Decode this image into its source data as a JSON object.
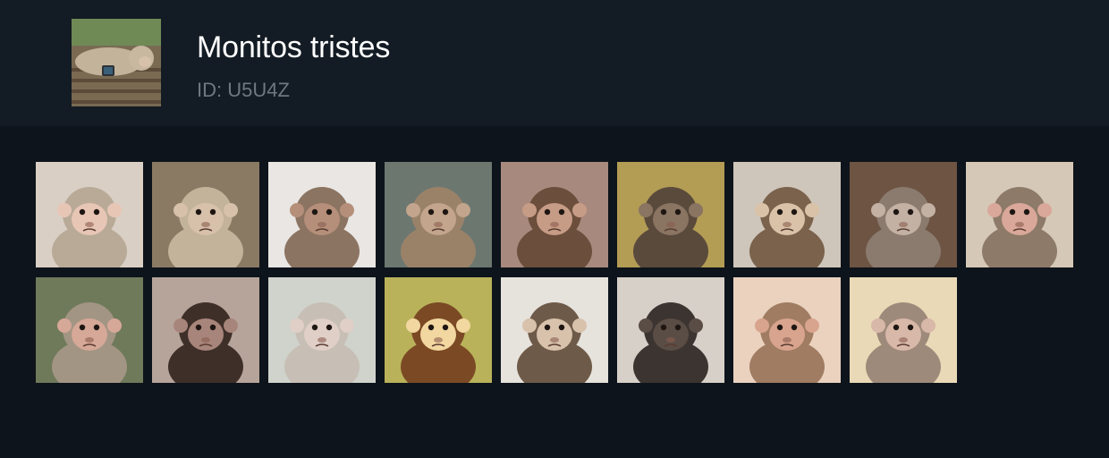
{
  "pack": {
    "title": "Monitos tristes",
    "id_label": "ID: U5U4Z",
    "cover_sticker": "sleeping-monkey-with-phone-sticker"
  },
  "stickers": [
    {
      "name": "staring-macaque-sticker",
      "bg": "#d9cfc4",
      "fur": "#b9aa98",
      "face": "#e8c6b6"
    },
    {
      "name": "sleeping-monkey-with-phone-sticker",
      "bg": "#8a7a63",
      "fur": "#c2b39a",
      "face": "#d7c1ab"
    },
    {
      "name": "monkey-looking-up-sticker",
      "bg": "#e9e6e3",
      "fur": "#8c7462",
      "face": "#b58f7a"
    },
    {
      "name": "monkey-with-bottle-sticker",
      "bg": "#6c7770",
      "fur": "#9a8268",
      "face": "#c2a58c"
    },
    {
      "name": "monkey-hugging-plush-sticker",
      "bg": "#a8897e",
      "fur": "#6b4e3c",
      "face": "#c79c86"
    },
    {
      "name": "monkey-in-blue-outfit-sticker",
      "bg": "#b39c54",
      "fur": "#5a4a3c",
      "face": "#8a7462"
    },
    {
      "name": "capuchin-sitting-sticker",
      "bg": "#cfc6bb",
      "fur": "#7a624c",
      "face": "#d9c2a8"
    },
    {
      "name": "fluffy-baby-monkey-sticker",
      "bg": "#6d5443",
      "fur": "#8b7a6e",
      "face": "#c3b1a4"
    },
    {
      "name": "monkey-with-banana-peel-sticker",
      "bg": "#d5c8b6",
      "fur": "#8d7a68",
      "face": "#d9a89a"
    },
    {
      "name": "monkey-with-flower-sticker",
      "bg": "#6f7a5a",
      "fur": "#a39583",
      "face": "#d6a898"
    },
    {
      "name": "sleeping-chimp-sticker",
      "bg": "#b6a49a",
      "fur": "#3e2f29",
      "face": "#a8857a"
    },
    {
      "name": "lying-baby-monkey-sticker",
      "bg": "#cfd3cc",
      "fur": "#c7beb5",
      "face": "#e0cfc7"
    },
    {
      "name": "cartoon-monkey-sticker",
      "bg": "#b9b25a",
      "fur": "#7b4a25",
      "face": "#f2d7a0"
    },
    {
      "name": "capuchin-with-pink-bow-sticker",
      "bg": "#e6e2dc",
      "fur": "#6e5a48",
      "face": "#d8c2ac"
    },
    {
      "name": "back-view-monkey-sticker",
      "bg": "#d6d0c8",
      "fur": "#3c3430",
      "face": "#5a4d45"
    },
    {
      "name": "crying-baby-macaque-sticker",
      "bg": "#ead2bf",
      "fur": "#a07c62",
      "face": "#d8a48e"
    },
    {
      "name": "monkey-in-blue-shirt-sticker",
      "bg": "#e9d9b6",
      "fur": "#9e8a7a",
      "face": "#d8b8a8"
    }
  ]
}
